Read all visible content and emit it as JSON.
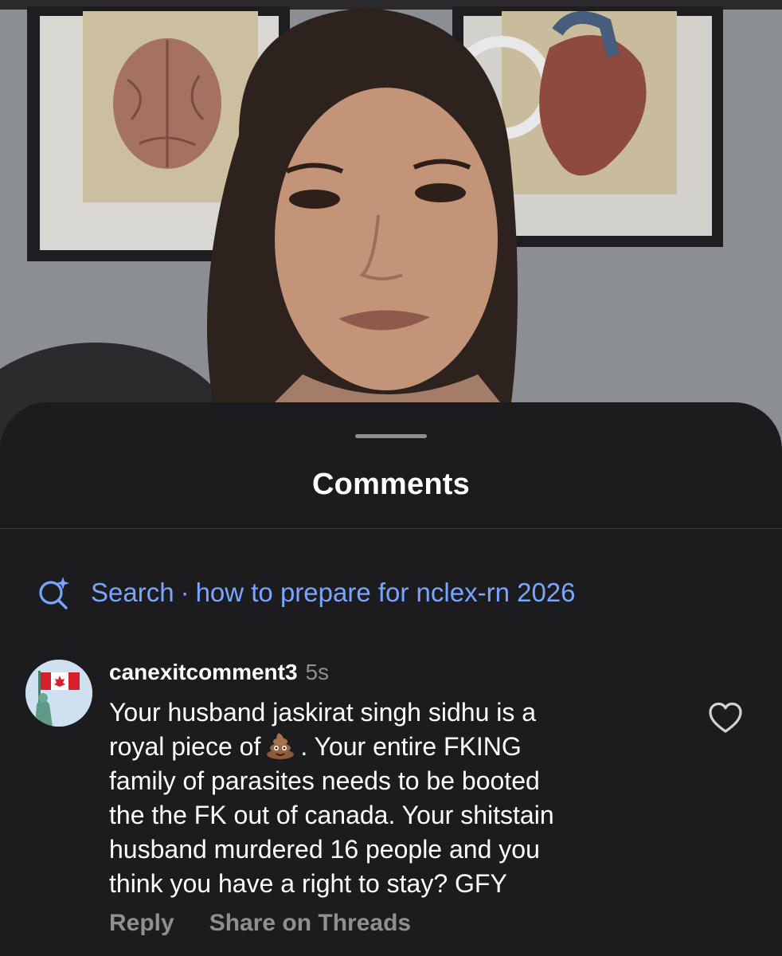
{
  "sheet": {
    "title": "Comments"
  },
  "search": {
    "label": "Search",
    "separator": "·",
    "query": "how to prepare for nclex-rn 2026",
    "icon": "sparkle-search-icon",
    "color": "#7aa5ff"
  },
  "comment": {
    "username": "canexitcomment3",
    "time": "5s",
    "avatar_icon": "canada-flag-statue-of-liberty-avatar",
    "lines": {
      "l1": "Your husband jaskirat singh sidhu is a",
      "l2a": "royal piece of",
      "l2b": ". Your entire FKING",
      "l3": "family of parasites needs to be booted",
      "l4": "the the FK out of canada. Your shitstain",
      "l5": "husband murdered 16 people and you",
      "l6": "think you have a right to stay? GFY"
    },
    "emoji_icon": "poop-emoji-icon",
    "like_icon": "heart-outline-icon"
  },
  "actions": {
    "reply": "Reply",
    "share": "Share on Threads"
  },
  "colors": {
    "sheet_bg": "#1c1c1e",
    "text": "#ffffff",
    "muted": "#8e8e93",
    "link": "#7aa5ff"
  }
}
